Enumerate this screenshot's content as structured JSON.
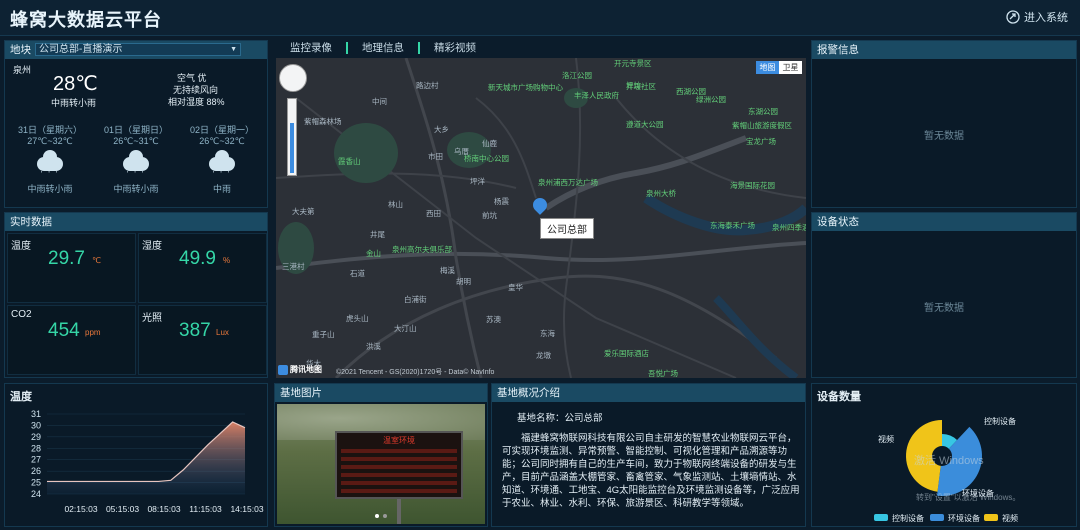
{
  "header": {
    "title": "蜂窝大数据云平台",
    "enter_label": "进入系统"
  },
  "base": {
    "label": "地块",
    "selected": "公司总部-直播演示"
  },
  "weather": {
    "city": "泉州",
    "temp": "28℃",
    "desc": "中雨转小雨",
    "aqi": "空气 优",
    "wind": "无持续风向",
    "humidity": "相对湿度 88%",
    "forecast": [
      {
        "date": "31日（星期六）",
        "range": "27℃~32℃",
        "desc": "中雨转小雨"
      },
      {
        "date": "01日（星期日）",
        "range": "26℃~31℃",
        "desc": "中雨转小雨"
      },
      {
        "date": "02日（星期一）",
        "range": "26℃~32℃",
        "desc": "中雨"
      }
    ]
  },
  "realtime": {
    "title": "实时数据",
    "cells": [
      {
        "label": "温度",
        "value": "29.7",
        "unit": "℃"
      },
      {
        "label": "湿度",
        "value": "49.9",
        "unit": "%"
      },
      {
        "label": "CO2",
        "value": "454",
        "unit": "ppm"
      },
      {
        "label": "光照",
        "value": "387",
        "unit": "Lux"
      }
    ]
  },
  "tabs": [
    "监控录像",
    "地理信息",
    "精彩视频"
  ],
  "map": {
    "type_normal": "地图",
    "type_satellite": "卫星",
    "marker_label": "公司总部",
    "copyright": "©2021 Tencent - GS(2020)1720号 - Data© NavInfo",
    "logo": "腾讯地图",
    "labels": [
      "紫帽森林场",
      "路边村",
      "中间",
      "大乡",
      "乌厝",
      "市田",
      "西田",
      "仙鹿",
      "杨震",
      "坪洋",
      "林山",
      "前坑",
      "大夫第",
      "井尾",
      "胡明",
      "三港村",
      "石道",
      "梅溪",
      "白浦街",
      "皇华",
      "虎头山",
      "大汀山",
      "重子山",
      "洪溪",
      "龙墩",
      "东海",
      "华大",
      "苏澳"
    ],
    "pois": [
      "新天城市广场购物中心",
      "洛江公园",
      "井埕社区",
      "开元寺景区",
      "坪坊",
      "西湖公园",
      "绿洲公园",
      "丰泽人民政府",
      "遵道大公园",
      "东湖公园",
      "紫帽山旅游度假区",
      "霞香山",
      "桥南中心公园",
      "泉州浦西万达广场",
      "泉州大桥",
      "海景国际花园",
      "东海泰禾广场",
      "泉州四季酒店",
      "金山",
      "泉州高尔夫俱乐部",
      "爱乐国际酒店",
      "吾悦广场",
      "宝龙广场"
    ]
  },
  "alarm": {
    "title": "报警信息",
    "empty": "暂无数据"
  },
  "device_status": {
    "title": "设备状态",
    "empty": "暂无数据"
  },
  "temperature": {
    "title": "温度"
  },
  "chart_data": {
    "type": "area",
    "title": "温度",
    "x_ticks": [
      "02:15:03",
      "05:15:03",
      "08:15:03",
      "11:15:03",
      "14:15:03"
    ],
    "y_ticks": [
      24,
      25,
      26,
      27,
      28,
      29,
      30,
      31
    ],
    "ylim": [
      24,
      31
    ],
    "x": [
      "02:15",
      "03:15",
      "04:15",
      "05:15",
      "06:15",
      "07:15",
      "08:15",
      "09:15",
      "10:15",
      "11:15",
      "11:45",
      "12:15",
      "12:45",
      "13:15",
      "13:45",
      "14:15",
      "14:45"
    ],
    "values": [
      25.1,
      25.1,
      25.1,
      25.1,
      25.1,
      25.1,
      25.1,
      25.1,
      25.1,
      25.1,
      25.2,
      26.1,
      27.2,
      28.3,
      29.3,
      30.3,
      29.8
    ]
  },
  "photo": {
    "title": "基地图片",
    "sign_title": "温室环境"
  },
  "overview": {
    "title": "基地概况介绍",
    "name_line": "基地名称：公司总部",
    "text": "福建蜂窝物联网科技有限公司自主研发的智慧农业物联网云平台，可实现环境监测、异常预警、智能控制、可视化管理和产品溯源等功能；公司同时拥有自己的生产车间，致力于物联网终端设备的研发与生产，目前产品涵盖大棚管家、畜禽管家、气象监测站、土壤墒情站、水知道、环境通、工地宝、4G太阳能监控台及环境监测设备等，广泛应用于农业、林业、水利、环保、旅游景区、科研教学等领域。"
  },
  "devices": {
    "title": "设备数量",
    "pie": [
      {
        "name": "控制设备",
        "value": 12,
        "color": "#37c6e3"
      },
      {
        "name": "环境设备",
        "value": 40,
        "color": "#3b8ddb"
      },
      {
        "name": "视频",
        "value": 48,
        "color": "#f0c419"
      }
    ]
  },
  "watermark": {
    "line1": "激活 Windows",
    "line2": "转到\"设置\"以激活 Windows。"
  }
}
